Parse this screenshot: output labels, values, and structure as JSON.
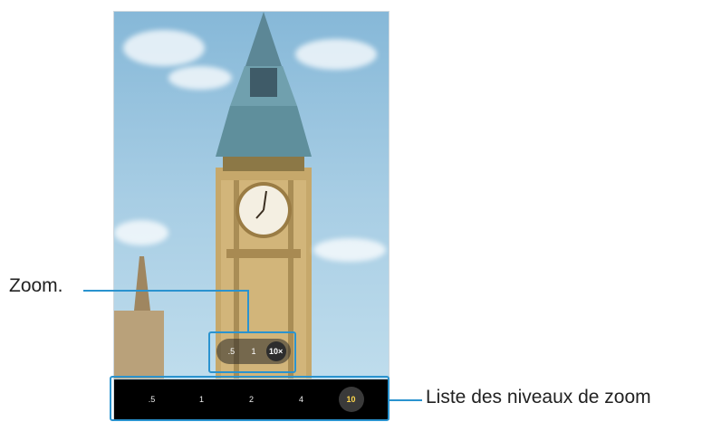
{
  "callouts": {
    "zoom": "Zoom.",
    "levels_list": "Liste des niveaux de zoom"
  },
  "quick_zoom": {
    "buttons": [
      ".5",
      "1",
      "10×"
    ],
    "active_index": 2
  },
  "zoom_levels": {
    "items": [
      ".5",
      "1",
      "2",
      "4",
      "10"
    ],
    "active_index": 4
  },
  "colors": {
    "accent": "#2a93cf",
    "active_level": "#ffd84d",
    "bar_background": "#000000"
  },
  "icons": {
    "viewfinder": "camera-viewfinder-image"
  }
}
